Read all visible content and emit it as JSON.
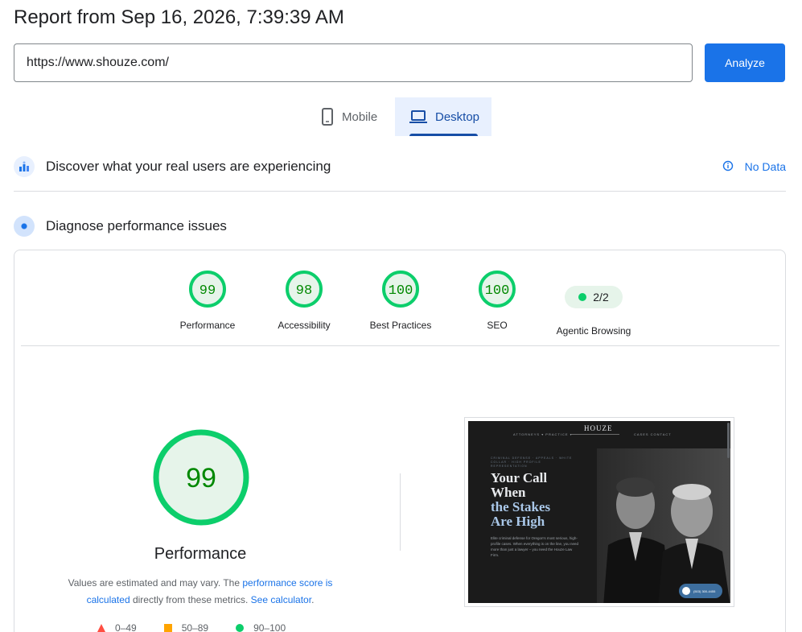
{
  "header": {
    "title": "Report from Sep 16, 2026, 7:39:39 AM"
  },
  "url_bar": {
    "value": "https://www.shouze.com/",
    "analyze_label": "Analyze"
  },
  "tabs": [
    {
      "label": "Mobile",
      "selected": false,
      "icon": "phone-icon"
    },
    {
      "label": "Desktop",
      "selected": true,
      "icon": "laptop-icon"
    }
  ],
  "crux": {
    "title": "Discover what your real users are experiencing",
    "status": "No Data",
    "icon": "users-chart-icon",
    "status_icon": "info-icon"
  },
  "diagnose": {
    "title": "Diagnose performance issues",
    "icon": "lighthouse-icon"
  },
  "scores": [
    {
      "label": "Performance",
      "value": 99
    },
    {
      "label": "Accessibility",
      "value": 98
    },
    {
      "label": "Best Practices",
      "value": 100
    },
    {
      "label": "SEO",
      "value": 100
    }
  ],
  "agentic": {
    "label": "Agentic Browsing",
    "value": "2/2"
  },
  "performance": {
    "value": 99,
    "title": "Performance",
    "explain_prefix": "Values are estimated and may vary. The ",
    "explain_link1": "performance score is calculated",
    "explain_middle": " directly from these metrics. ",
    "explain_link2": "See calculator",
    "explain_suffix": "."
  },
  "legend": [
    {
      "range": "0–49",
      "shape": "triangle",
      "color": "#ff4e42"
    },
    {
      "range": "50–89",
      "shape": "square",
      "color": "#ffa400"
    },
    {
      "range": "90–100",
      "shape": "circle",
      "color": "#0cce6b"
    }
  ],
  "screenshot": {
    "logo": "HOUZE",
    "nav_left": "ATTORNEYS ▾     PRACTICE ▾",
    "nav_right": "CASES     CONTACT",
    "kicker": "CRIMINAL DEFENSE · APPEALS · WHITE COLLAR · HIGH PROFILE REPRESENTATION",
    "headline_l1": "Your Call",
    "headline_l2": "When",
    "headline_l3": "the Stakes",
    "headline_l4": "Are High",
    "body": "Elite criminal defense for Oregon's most serious, high-profile cases. When everything is on the line, you need more than just a lawyer – you need the Houze Law Firm.",
    "call_label": "(503) 300-4455"
  },
  "colors": {
    "accent": "#1a73e8",
    "good": "#0cce6b",
    "good_text": "#008800",
    "good_fill": "#e6f4ea"
  }
}
